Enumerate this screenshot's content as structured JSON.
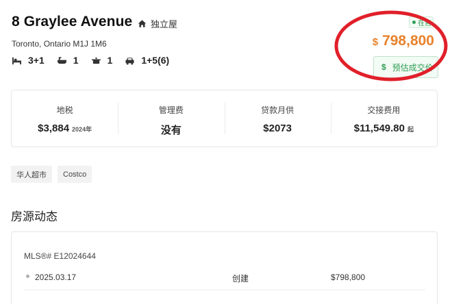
{
  "listing": {
    "address_line1": "8 Graylee Avenue",
    "property_type": "独立屋",
    "address_line2": "Toronto, Ontario M1J 1M6",
    "specs": {
      "bedrooms": "3+1",
      "bathrooms": "1",
      "kitchens": "1",
      "parking": "1+5(6)"
    },
    "status": "在售",
    "price_currency": "$",
    "price": "798,800",
    "estimate_label": "预估成交价",
    "estimate_currency": "$",
    "colors": {
      "price": "#e8822b",
      "accent_green": "#2f9e55",
      "annotation_red": "#e0202a"
    }
  },
  "stats": {
    "tax": {
      "label": "地税",
      "value": "$3,884",
      "note": "2024年"
    },
    "management_fee": {
      "label": "管理费",
      "value": "没有"
    },
    "mortgage": {
      "label": "贷款月供",
      "value": "$2073"
    },
    "closing_cost": {
      "label": "交接费用",
      "value": "$11,549.80",
      "note": "起"
    }
  },
  "tags": [
    "华人超市",
    "Costco"
  ],
  "history": {
    "section_title": "房源动态",
    "mls_label": "MLS®# E12024644",
    "rows": [
      {
        "date": "2025.03.17",
        "event": "创建",
        "price": "$798,800"
      }
    ]
  }
}
